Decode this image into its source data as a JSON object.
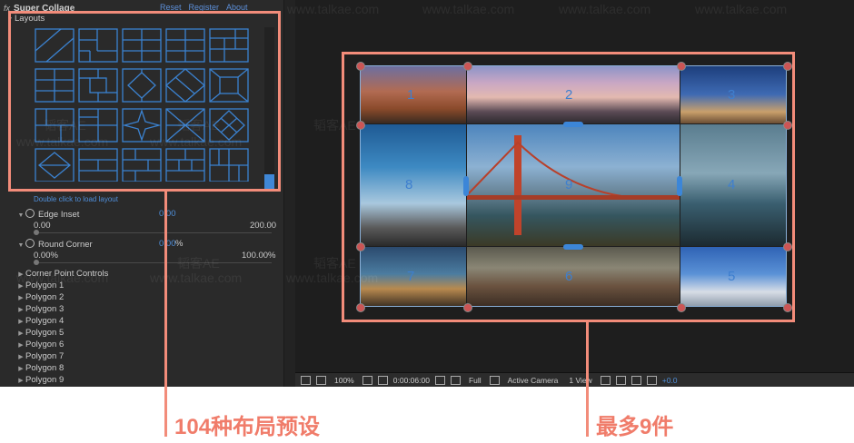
{
  "panel": {
    "fx": "fx",
    "title": "Super Collage",
    "links": [
      "Reset",
      "Register",
      "About"
    ],
    "layouts_label": "Layouts",
    "load_hint": "Double click to load layout",
    "edge_inset": {
      "label": "Edge Inset",
      "value": "0.00",
      "min": "0.00",
      "max": "200.00",
      "level": 0
    },
    "round_corner": {
      "label": "Round Corner",
      "value": "0.00",
      "unit": "%",
      "min": "0.00%",
      "max": "100.00%",
      "level": 0
    },
    "corner_point_controls": "Corner Point Controls",
    "polygons": [
      "Polygon 1",
      "Polygon 2",
      "Polygon 3",
      "Polygon 4",
      "Polygon 5",
      "Polygon 6",
      "Polygon 7",
      "Polygon 8",
      "Polygon 9"
    ]
  },
  "viewer": {
    "photos": [
      {
        "num": "1"
      },
      {
        "num": "2"
      },
      {
        "num": "3"
      },
      {
        "num": "8"
      },
      {
        "num": "9"
      },
      {
        "num": "4"
      },
      {
        "num": "7"
      },
      {
        "num": "6"
      },
      {
        "num": "5"
      }
    ]
  },
  "toolbar": {
    "zoom": "100%",
    "timecode": "0:00:06:00",
    "resolution": "Full",
    "camera": "Active Camera",
    "views": "1 View",
    "exposure": "+0.0"
  },
  "watermark": "www.talkae.com",
  "watermark_cn": "韬客AE",
  "captions": {
    "left": "104种布局预设",
    "right": "最多9件"
  },
  "colors": {
    "accent": "#f28c7a",
    "link": "#5d8fd8",
    "grid_line": "#3b82d0"
  }
}
